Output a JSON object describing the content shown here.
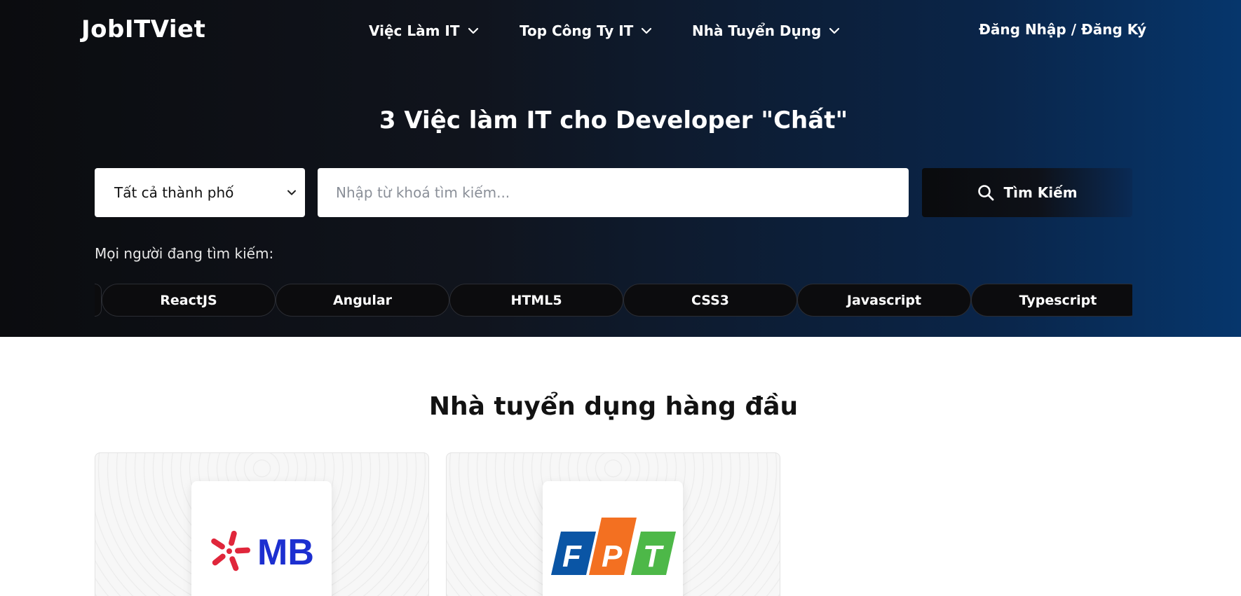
{
  "header": {
    "logo": "JobITViet",
    "nav": [
      {
        "label": "Việc Làm IT"
      },
      {
        "label": "Top Công Ty IT"
      },
      {
        "label": "Nhà Tuyển Dụng"
      }
    ],
    "login": "Đăng Nhập / Đăng Ký"
  },
  "hero": {
    "title": "3 Việc làm IT cho Developer \"Chất\"",
    "city_select": {
      "value": "Tất cả thành phố"
    },
    "search": {
      "placeholder": "Nhập từ khoá tìm kiếm..."
    },
    "search_button": "Tìm Kiếm",
    "popular_label": "Mọi người đang tìm kiếm:",
    "tags": [
      "ReactJS",
      "Angular",
      "HTML5",
      "CSS3",
      "Javascript",
      "Typescript"
    ]
  },
  "employers": {
    "title": "Nhà tuyển dụng hàng đầu",
    "items": [
      {
        "logo_text": "MB",
        "logo_color": "#1c2fd0",
        "mark_color": "#e0263b"
      },
      {
        "logo_text": "FPT",
        "colors": [
          "#0a55a5",
          "#f37021",
          "#4db848"
        ]
      }
    ]
  },
  "colors": {
    "hero_dark": "#0b0c0f",
    "hero_blue": "#06366c"
  }
}
